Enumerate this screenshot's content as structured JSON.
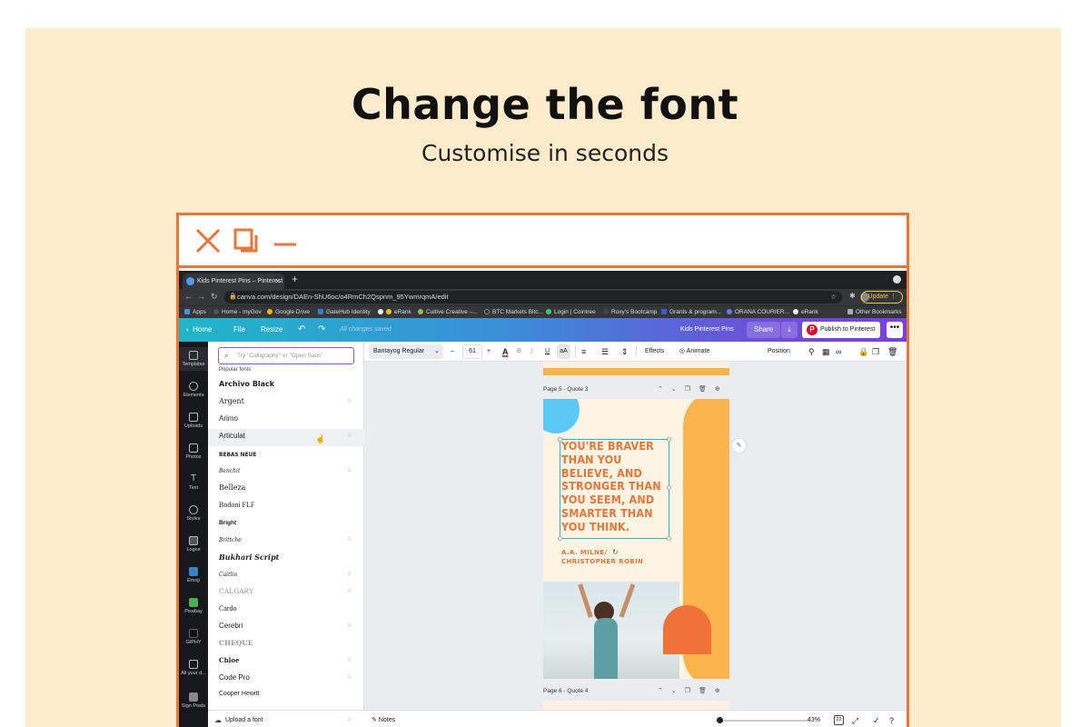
{
  "hero": {
    "title": "Change the font",
    "subtitle": "Customise in seconds"
  },
  "frame_icons": [
    "close-x-icon",
    "duplicate-icon",
    "minimize-icon"
  ],
  "browser": {
    "tab_title": "Kids Pinterest Pins – Pinterest",
    "tab_close": "×",
    "new_tab": "+",
    "url": "canva.com/design/DAEn-ShU6oc/o4RmCh2Qspnm_95YwmrqmA/edit",
    "update_label": "Update",
    "bookmarks": [
      "Apps",
      "Home - myGov",
      "Google Drive",
      "GateHub Identity",
      "eRank",
      "Cultive Creative –...",
      "BTC Markets Bitc...",
      "Login | Cointree",
      "Roxy's Bootcamp",
      "Grants & program...",
      "ORANA COURIER...",
      "eRank",
      "Other Bookmarks"
    ]
  },
  "canva_header": {
    "home": "Home",
    "file": "File",
    "resize": "Resize",
    "saved": "All changes saved",
    "design_title": "Kids Pinterest Pins",
    "share": "Share",
    "publish": "Publish to Pinterest",
    "more": "•••"
  },
  "sidenav": [
    "Templates",
    "Elements",
    "Uploads",
    "Photos",
    "Text",
    "Styles",
    "Logos",
    "Emoji",
    "Pixabay",
    "GIPHY",
    "All your d...",
    "Sign Posts"
  ],
  "font_panel": {
    "search_placeholder": "Try \"Calligraphy\" or \"Open Sans\"",
    "section_label": "Popular fonts",
    "fonts": [
      "Archivo Black",
      "Argent",
      "Arimo",
      "Articulat",
      "BEBAS NEUE",
      "Benchit",
      "Belleza",
      "Bodoni FLF",
      "Bright",
      "Brittche",
      "Bukhari Script",
      "Caitlin",
      "CALGARY",
      "Cardo",
      "Cerebri",
      "CHEQUE",
      "Chloe",
      "Code Pro",
      "Cooper Hewitt"
    ],
    "upload_label": "Upload a font"
  },
  "toolbar": {
    "font_name": "Bantayog Regular",
    "minus": "–",
    "size": "61",
    "plus": "+",
    "text_color_letter": "A",
    "bold": "B",
    "italic": "I",
    "underline": "U",
    "case": "aA",
    "effects": "Effects",
    "animate": "Animate",
    "position": "Position"
  },
  "canvas": {
    "page5_label": "Page 5 - Quote 3",
    "page6_label": "Page 6 - Quote 4",
    "quote_lines": [
      "YOU'RE BRAVER",
      "THAN YOU",
      "BELIEVE, AND",
      "STRONGER THAN",
      "YOU SEEM, AND",
      "SMARTER THAN",
      "YOU THINK."
    ],
    "author_line1": "A.A. MILNE/",
    "author_line2": "CHRISTOPHER ROBIN"
  },
  "statusbar": {
    "notes": "Notes",
    "zoom": "43%",
    "page_count": "22",
    "zoom_level": 0.43
  },
  "colors": {
    "frame_border": "#e8763a",
    "background": "#fdebcc",
    "quote_orange": "#e8763a",
    "accent_purple": "#7b3fe0"
  }
}
